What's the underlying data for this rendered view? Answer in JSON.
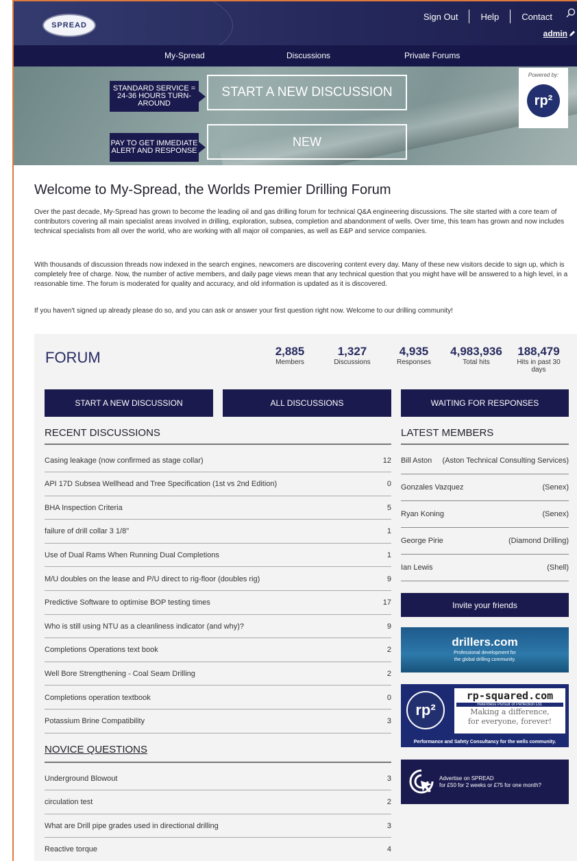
{
  "header": {
    "logo_text": "SPREAD",
    "links": [
      "Sign Out",
      "Help",
      "Contact"
    ],
    "user": "admin"
  },
  "nav": {
    "items": [
      "My-Spread",
      "Discussions",
      "Private Forums"
    ]
  },
  "banner": {
    "standard_tag": "STANDARD SERVICE = 24-36 HOURS TURN-AROUND",
    "start_button": "START A NEW DISCUSSION",
    "pay_tag": "PAY TO GET IMMEDIATE ALERT AND RESPONSE",
    "new_button": "NEW",
    "powered_by": "Powered by:",
    "powered_logo": "rp²"
  },
  "intro": {
    "title": "Welcome to My-Spread, the Worlds Premier Drilling Forum",
    "p1": "Over the past decade, My-Spread has grown to become the leading oil and gas drilling forum for technical Q&A engineering discussions. The site started with a core team of contributors covering all main specialist areas involved in drilling, exploration, subsea, completion and abandonment of wells. Over time, this team has grown and now includes technical specialists from all over the world, who are working with all major oil companies, as well as E&P and service companies.",
    "p2": "With thousands of discussion threads now indexed in the search engines, newcomers are discovering content every day. Many of these new visitors decide to sign up, which is completely free of charge. Now, the number of active members, and daily page views mean that any technical question that you might have will be answered to a high level, in a reasonable time. The forum is moderated for quality and accuracy, and old information is updated as it is discovered.",
    "p3": "If you haven't signed up already please do so, and you can ask or answer your first question right now. Welcome to our drilling community!"
  },
  "forum": {
    "title": "FORUM",
    "stats": [
      {
        "num": "2,885",
        "label": "Members"
      },
      {
        "num": "1,327",
        "label": "Discussions"
      },
      {
        "num": "4,935",
        "label": "Responses"
      },
      {
        "num": "4,983,936",
        "label": "Total hits"
      },
      {
        "num": "188,479",
        "label": "Hits in past 30 days"
      }
    ],
    "buttons": [
      "START A NEW DISCUSSION",
      "ALL DISCUSSIONS",
      "WAITING FOR RESPONSES"
    ],
    "recent_title": "RECENT DISCUSSIONS",
    "recent": [
      {
        "title": "Casing leakage (now confirmed as stage collar)",
        "count": "12"
      },
      {
        "title": "API 17D Subsea Wellhead and Tree Specification (1st vs 2nd Edition)",
        "count": "0"
      },
      {
        "title": "BHA Inspection Criteria",
        "count": "5"
      },
      {
        "title": "failure of drill collar 3 1/8\"",
        "count": "1"
      },
      {
        "title": "Use of Dual Rams When Running Dual Completions",
        "count": "1"
      },
      {
        "title": "M/U doubles on the lease and P/U direct to rig-floor (doubles rig)",
        "count": "9"
      },
      {
        "title": "Predictive Software to optimise BOP testing times",
        "count": "17"
      },
      {
        "title": "Who is still using NTU as a cleanliness indicator (and why)?",
        "count": "9"
      },
      {
        "title": "Completions Operations text book",
        "count": "2"
      },
      {
        "title": "Well Bore Strengthening - Coal Seam Drilling",
        "count": "2"
      },
      {
        "title": "Completions operation textbook",
        "count": "0"
      },
      {
        "title": "Potassium Brine Compatibility",
        "count": "3"
      }
    ],
    "novice_title": "NOVICE QUESTIONS",
    "novice": [
      {
        "title": "Underground Blowout",
        "count": "3"
      },
      {
        "title": "circulation test",
        "count": "2"
      },
      {
        "title": "What are Drill pipe grades used in directional drilling",
        "count": "3"
      },
      {
        "title": "Reactive torque",
        "count": "4"
      }
    ],
    "members_title": "LATEST MEMBERS",
    "members": [
      {
        "name": "Bill Aston",
        "company": "(Aston Technical Consulting Services)"
      },
      {
        "name": "Gonzales Vazquez",
        "company": "(Senex)"
      },
      {
        "name": "Ryan Koning",
        "company": "(Senex)"
      },
      {
        "name": "George Pirie",
        "company": "(Diamond Drilling)"
      },
      {
        "name": "Ian Lewis",
        "company": "(Shell)"
      }
    ],
    "invite": "Invite your friends"
  },
  "ads": {
    "drillers_title": "drillers.com",
    "drillers_sub1": "Professional development for",
    "drillers_sub2": "the global drilling community.",
    "rp_logo": "rp²",
    "rp_url": "rp-squared.com",
    "rp_tagline": "Relentless Pursuit of Perfection Ltd.",
    "rp_slogan1": "Making a difference,",
    "rp_slogan2": "for everyone, forever!",
    "rp_footer": "Performance and Safety Consultancy for the wells community.",
    "advertise1": "Advertise on SPREAD",
    "advertise2": "for £50 for 2 weeks or £75 for one month?"
  }
}
